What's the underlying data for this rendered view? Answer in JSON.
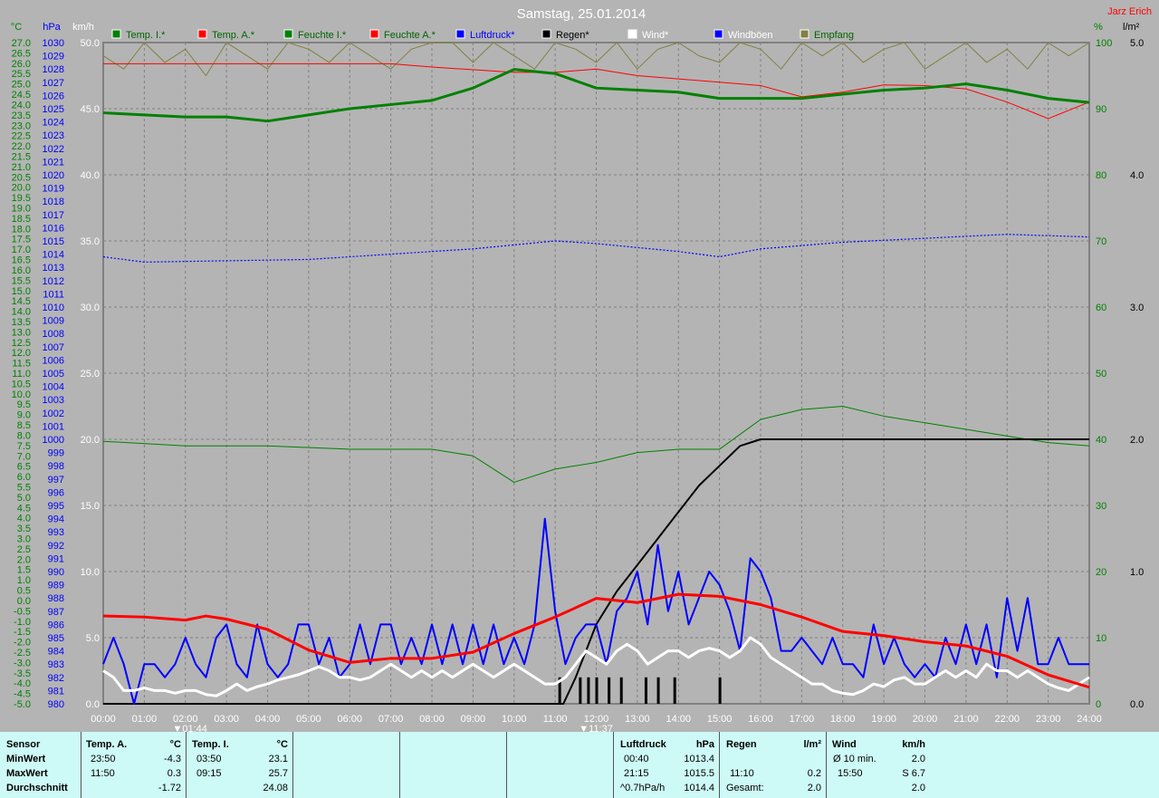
{
  "title": "Samstag, 25.01.2014",
  "author": "Jarz Erich",
  "legend": [
    {
      "label": "Temp. I.*",
      "color": "#008000",
      "text": "#006400"
    },
    {
      "label": "Temp. A.*",
      "color": "#ff0000",
      "text": "#006400"
    },
    {
      "label": "Feuchte I.*",
      "color": "#008000",
      "text": "#006400"
    },
    {
      "label": "Feuchte A.*",
      "color": "#ff0000",
      "text": "#006400"
    },
    {
      "label": "Luftdruck*",
      "color": "#0000ff",
      "text": "#0000ff"
    },
    {
      "label": "Regen*",
      "color": "#000000",
      "text": "#000000"
    },
    {
      "label": "Wind*",
      "color": "#ffffff",
      "text": "#ffffff"
    },
    {
      "label": "Windböen",
      "color": "#0000ff",
      "text": "#ffffff"
    },
    {
      "label": "Empfang",
      "color": "#808040",
      "text": "#006400"
    }
  ],
  "chart_data": {
    "type": "line",
    "title": "Samstag, 25.01.2014",
    "x_labels": [
      "00:00",
      "01:00",
      "02:00",
      "03:00",
      "04:00",
      "05:00",
      "06:00",
      "07:00",
      "08:00",
      "09:00",
      "10:00",
      "11:00",
      "12:00",
      "13:00",
      "14:00",
      "15:00",
      "16:00",
      "17:00",
      "18:00",
      "19:00",
      "20:00",
      "21:00",
      "22:00",
      "23:00",
      "24:00"
    ],
    "axes": {
      "temp": {
        "unit": "°C",
        "min": -5,
        "max": 27,
        "step": 0.5
      },
      "pressure": {
        "unit": "hPa",
        "min": 980,
        "max": 1030,
        "step": 1
      },
      "wind": {
        "unit": "km/h",
        "min": 0,
        "max": 50,
        "step": 5
      },
      "humidity": {
        "unit": "%",
        "min": 0,
        "max": 100,
        "step": 10
      },
      "rain": {
        "unit": "l/m²",
        "min": 0,
        "max": 5,
        "step": 1
      }
    },
    "markers": [
      {
        "label": "01:44",
        "hour": 1.73
      },
      {
        "label": "11:37",
        "hour": 11.62
      }
    ],
    "series": {
      "temp_in": {
        "axis": "temp",
        "hours": [
          0,
          1,
          2,
          3,
          4,
          5,
          6,
          7,
          8,
          9,
          10,
          11,
          12,
          13,
          14,
          15,
          16,
          17,
          18,
          19,
          20,
          21,
          22,
          23,
          24
        ],
        "values": [
          23.6,
          23.5,
          23.4,
          23.4,
          23.2,
          23.5,
          23.8,
          24.0,
          24.2,
          24.8,
          25.7,
          25.5,
          24.8,
          24.7,
          24.6,
          24.3,
          24.3,
          24.3,
          24.5,
          24.7,
          24.8,
          25.0,
          24.7,
          24.3,
          24.1
        ]
      },
      "temp_out": {
        "axis": "temp",
        "hours": [
          0,
          1,
          2,
          2.5,
          3,
          4,
          5,
          6,
          7,
          8,
          9,
          10,
          11,
          12,
          13,
          14,
          15,
          16,
          17,
          18,
          19,
          20,
          21,
          22,
          23,
          24
        ],
        "values": [
          -0.75,
          -0.8,
          -0.95,
          -0.75,
          -0.9,
          -1.4,
          -2.4,
          -3.0,
          -2.8,
          -2.8,
          -2.5,
          -1.6,
          -0.8,
          0.1,
          -0.1,
          0.3,
          0.2,
          -0.2,
          -0.8,
          -1.5,
          -1.7,
          -2.0,
          -2.2,
          -2.7,
          -3.6,
          -4.2
        ]
      },
      "hum_in": {
        "axis": "humidity",
        "hours": [
          0,
          2,
          4,
          6,
          8,
          9,
          10,
          11,
          12,
          13,
          14,
          15,
          16,
          17,
          18,
          19,
          20,
          21,
          22,
          23,
          24
        ],
        "values": [
          39.7,
          39,
          39,
          38.5,
          38.5,
          37.5,
          33.5,
          35.5,
          36.5,
          38,
          38.5,
          38.5,
          43,
          44.5,
          45,
          43.5,
          42.5,
          41.5,
          40.5,
          39.5,
          39
        ]
      },
      "hum_out": {
        "axis": "humidity",
        "hours": [
          0,
          7,
          8,
          10,
          11,
          12,
          13,
          14,
          15,
          16,
          17,
          18,
          19,
          20,
          21,
          22,
          23,
          24
        ],
        "values": [
          96.8,
          96.8,
          96.3,
          95.5,
          95.5,
          96,
          95,
          94.5,
          94,
          93.5,
          91.8,
          92.5,
          93.6,
          93.5,
          93,
          91,
          88.5,
          91
        ]
      },
      "pressure": {
        "axis": "pressure",
        "hours": [
          0,
          1,
          3,
          5,
          7,
          9,
          11,
          12,
          14,
          15,
          16,
          18,
          20,
          22,
          24
        ],
        "values": [
          1013.8,
          1013.4,
          1013.5,
          1013.6,
          1014.0,
          1014.4,
          1015.0,
          1014.8,
          1014.2,
          1013.8,
          1014.4,
          1014.9,
          1015.2,
          1015.5,
          1015.3
        ]
      },
      "rain_total": {
        "axis": "rain",
        "hours": [
          0,
          11.2,
          11.5,
          12,
          12.5,
          13,
          13.5,
          14,
          14.5,
          15,
          15.5,
          16,
          24
        ],
        "values": [
          0,
          0,
          0.2,
          0.6,
          0.85,
          1.05,
          1.25,
          1.45,
          1.65,
          1.8,
          1.95,
          2.0,
          2.0
        ]
      },
      "rain_bars": {
        "axis": "rain",
        "hours": [
          11.1,
          11.6,
          11.8,
          12.0,
          12.3,
          12.6,
          13.2,
          13.5,
          13.9,
          15.0
        ],
        "values": [
          0.2,
          0.2,
          0.2,
          0.2,
          0.2,
          0.2,
          0.2,
          0.2,
          0.2,
          0.2
        ]
      },
      "wind": {
        "axis": "wind",
        "interval_min": 15,
        "values": [
          2.5,
          2,
          1,
          1,
          1.2,
          1,
          1,
          0.8,
          1,
          1,
          0.7,
          0.6,
          1,
          1.5,
          1,
          1.3,
          1.5,
          1.8,
          2,
          2.2,
          2.5,
          2.8,
          2.5,
          2,
          2,
          1.8,
          2,
          2.5,
          3,
          2.5,
          2,
          2.5,
          2,
          2.5,
          2,
          2.5,
          3,
          2.5,
          2,
          2.5,
          3,
          2.5,
          2,
          1.5,
          1.5,
          2,
          3,
          4,
          3.5,
          3,
          4,
          4.5,
          4,
          3,
          3.5,
          4,
          4,
          3.5,
          4,
          4.2,
          4,
          3.5,
          4,
          5,
          4.5,
          3.5,
          3,
          2.5,
          2,
          1.5,
          1.5,
          1,
          0.8,
          0.7,
          1,
          1.5,
          1.3,
          1.8,
          2,
          1.5,
          1.5,
          2,
          2.5,
          2,
          2.5,
          2,
          3,
          2.5,
          2.5,
          2,
          2.5,
          2,
          1.5,
          1.2,
          1,
          1.5,
          2
        ]
      },
      "gusts": {
        "axis": "wind",
        "interval_min": 15,
        "values": [
          3,
          5,
          3,
          0,
          3,
          3,
          2,
          3,
          5,
          3,
          2,
          5,
          6,
          3,
          2,
          6,
          3,
          2,
          3,
          6,
          6,
          3,
          5,
          2,
          3,
          6,
          3,
          6,
          6,
          3,
          5,
          3,
          6,
          3,
          6,
          3,
          6,
          3,
          6,
          3,
          5,
          3,
          6,
          14,
          7,
          3,
          5,
          6,
          6,
          3,
          7,
          8,
          10,
          6,
          12,
          7,
          10,
          6,
          8,
          10,
          9,
          7,
          4,
          11,
          10,
          8,
          4,
          4,
          5,
          4,
          3,
          5,
          3,
          3,
          2,
          6,
          3,
          5,
          3,
          2,
          3,
          2,
          5,
          3,
          6,
          3,
          6,
          2,
          8,
          4,
          8,
          3,
          3,
          5,
          3,
          3,
          3
        ]
      },
      "reception": {
        "axis": "humidity",
        "interval_min": 30,
        "values": [
          98,
          96,
          100,
          97,
          99,
          95,
          100,
          98,
          96,
          100,
          99,
          97,
          100,
          98,
          96,
          99,
          100,
          100,
          97,
          100,
          98,
          96,
          100,
          99,
          97,
          100,
          96,
          99,
          100,
          98,
          97,
          100,
          99,
          96,
          100,
          98,
          100,
          97,
          99,
          100,
          96,
          98,
          100,
          97,
          99,
          96,
          100,
          98,
          100
        ]
      }
    }
  },
  "stats": {
    "sensor_label": "Sensor",
    "min_label": "MinWert",
    "max_label": "MaxWert",
    "avg_label": "Durchschnitt",
    "temp_out": {
      "name": "Temp. A.",
      "unit": "°C",
      "min_time": "23:50",
      "min": "-4.3",
      "max_time": "11:50",
      "max": "0.3",
      "avg": "-1.72"
    },
    "temp_in": {
      "name": "Temp. I.",
      "unit": "°C",
      "min_time": "03:50",
      "min": "23.1",
      "max_time": "09:15",
      "max": "25.7",
      "avg": "24.08"
    },
    "pressure": {
      "name": "Luftdruck",
      "unit": "hPa",
      "min_time": "00:40",
      "min": "1013.4",
      "max_time": "21:15",
      "max": "1015.5",
      "trend": "^0.7hPa/h",
      "avg": "1014.4"
    },
    "rain": {
      "name": "Regen",
      "unit": "l/m²",
      "max_time": "11:10",
      "max": "0.2",
      "total_label": "Gesamt:",
      "total": "2.0"
    },
    "wind": {
      "name": "Wind",
      "unit": "km/h",
      "avg_label": "Ø 10 min.",
      "avg10": "2.0",
      "max_time": "15:50",
      "max": "S 6.7",
      "avg": "2.0"
    }
  }
}
